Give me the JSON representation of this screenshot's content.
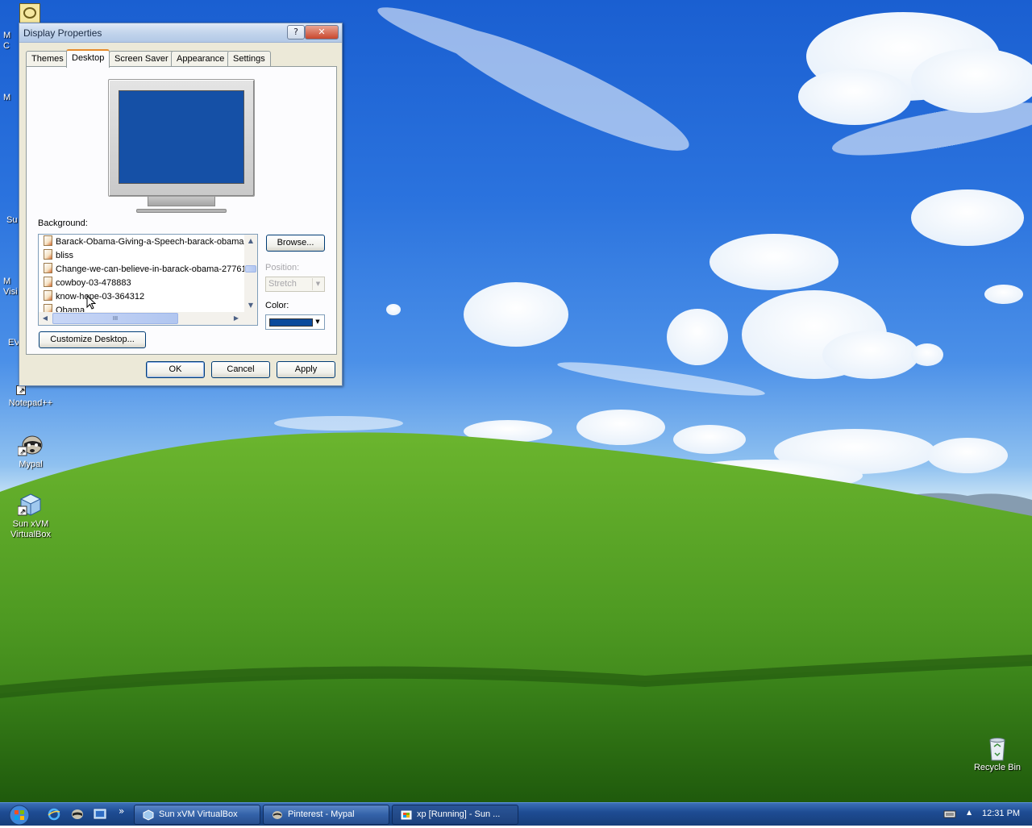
{
  "colors": {
    "desktop_color": "#1550a6",
    "dialog_face": "#ece9d8",
    "taskbar": "#1e4c93"
  },
  "desktop": {
    "edge_labels": [
      "M",
      "C",
      "M",
      "Su",
      "M",
      "Visi",
      "EV"
    ],
    "icons": [
      {
        "label": "Notepad++",
        "icon": "notepad-plus-icon"
      },
      {
        "label": "Mypal",
        "icon": "mypal-raccoon-icon"
      },
      {
        "label": "Sun xVM VirtualBox",
        "icon": "virtualbox-cube-icon"
      },
      {
        "label": "Recycle Bin",
        "icon": "recycle-bin-icon"
      }
    ]
  },
  "dialog": {
    "title": "Display Properties",
    "help_label": "?",
    "close_label": "✕",
    "tabs": [
      {
        "label": "Themes"
      },
      {
        "label": "Desktop"
      },
      {
        "label": "Screen Saver"
      },
      {
        "label": "Appearance"
      },
      {
        "label": "Settings"
      }
    ],
    "active_tab": "Desktop",
    "background_label": "Background:",
    "background_items": [
      "Barack-Obama-Giving-a-Speech-barack-obama-",
      "bliss",
      "Change-we-can-believe-in-barack-obama-27761(",
      "cowboy-03-478883",
      "know-hope-03-364312",
      "Obama"
    ],
    "browse_label": "Browse...",
    "position_label": "Position:",
    "position_value": "Stretch",
    "color_label": "Color:",
    "color_value": "#0a4a9c",
    "customize_label": "Customize Desktop...",
    "ok_label": "OK",
    "cancel_label": "Cancel",
    "apply_label": "Apply",
    "hscroll_grip": "III"
  },
  "taskbar": {
    "tasks": [
      {
        "label": "Sun xVM VirtualBox",
        "icon": "virtualbox-cube-icon"
      },
      {
        "label": "Pinterest - Mypal",
        "icon": "mypal-raccoon-icon"
      },
      {
        "label": "xp [Running] - Sun ...",
        "icon": "virtualbox-window-icon"
      }
    ],
    "overflow_label": "»",
    "tray_arrow": "▲",
    "clock": "12:31 PM"
  }
}
